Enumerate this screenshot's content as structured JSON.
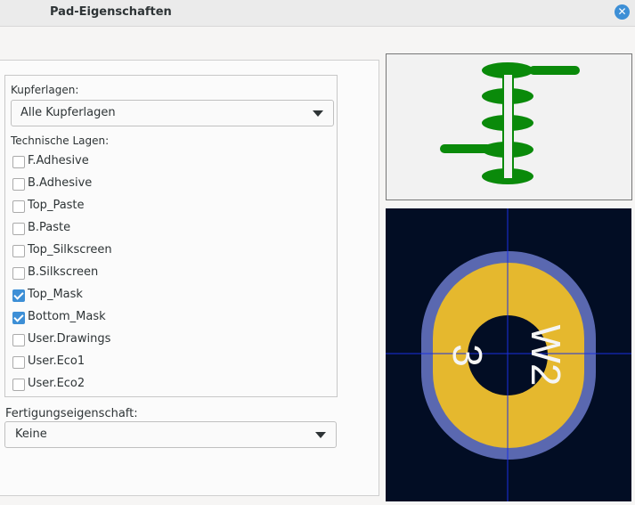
{
  "window": {
    "title": "Pad-Eigenschaften"
  },
  "copper": {
    "label": "Kupferlagen:",
    "selected": "Alle Kupferlagen"
  },
  "technical": {
    "label": "Technische Lagen:",
    "layers": [
      {
        "name": "F.Adhesive",
        "checked": false
      },
      {
        "name": "B.Adhesive",
        "checked": false
      },
      {
        "name": "Top_Paste",
        "checked": false
      },
      {
        "name": "B.Paste",
        "checked": false
      },
      {
        "name": "Top_Silkscreen",
        "checked": false
      },
      {
        "name": "B.Silkscreen",
        "checked": false
      },
      {
        "name": "Top_Mask",
        "checked": true
      },
      {
        "name": "Bottom_Mask",
        "checked": true
      },
      {
        "name": "User.Drawings",
        "checked": false
      },
      {
        "name": "User.Eco1",
        "checked": false
      },
      {
        "name": "User.Eco2",
        "checked": false
      }
    ]
  },
  "fabrication": {
    "label": "Fertigungseigenschaft:",
    "selected": "Keine"
  },
  "pad_preview": {
    "pad_number": "3",
    "net_name": "W2",
    "pad_color": "#e5b82e",
    "outline_color": "#5a68b0",
    "hole_color": "#020d24"
  }
}
